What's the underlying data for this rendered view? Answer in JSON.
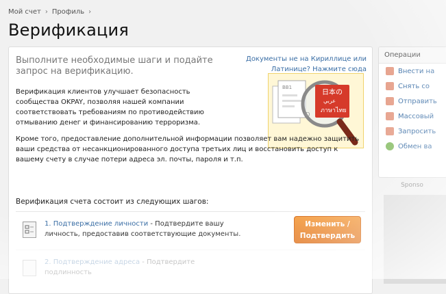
{
  "breadcrumb": {
    "items": [
      "Мой счет",
      "Профиль"
    ],
    "sep": "›"
  },
  "page": {
    "title": "Верификация"
  },
  "main": {
    "headline": "Выполните необходимые шаги и подайте запрос на верификацию.",
    "doc_link": "Документы не на Кириллице или Латинице? Нажмите сюда",
    "para1": "Верификация клиентов улучшает безопасность сообщества OKPAY, позволяя нашей компании соответствовать требованиям по противодействию отмыванию денег и финансированию терроризма.",
    "para2": "Кроме того, предоставление дополнительной информации позволяет вам надежно защитить ваши средства от несанкционированного доступа третьих лиц и восстановить доступ к вашему счету в случае потери адреса эл. почты, пароля и т.п.",
    "steps_title": "Верификация счета состоит из следующих шагов:",
    "steps": [
      {
        "title": "1. Подтверждение личности",
        "desc": " - Подтвердите вашу личность, предоставив соответствующие документы.",
        "button": "Изменить / Подтвердить"
      },
      {
        "title": "2. Подтверждение адреса",
        "desc": " - Подтвердите подлинность"
      }
    ]
  },
  "sidebar": {
    "title": "Операции",
    "items": [
      "Внести на",
      "Снять со",
      "Отправить",
      "Массовый",
      "Запросить",
      "Обмен ва"
    ]
  },
  "sponsor": {
    "label": "Sponso"
  },
  "illustration": {
    "label_jp": "日本の",
    "label_ar": "عربي",
    "label_th": "ภาษาไทย",
    "label_id": "ID",
    "label_ad": "BB1"
  }
}
